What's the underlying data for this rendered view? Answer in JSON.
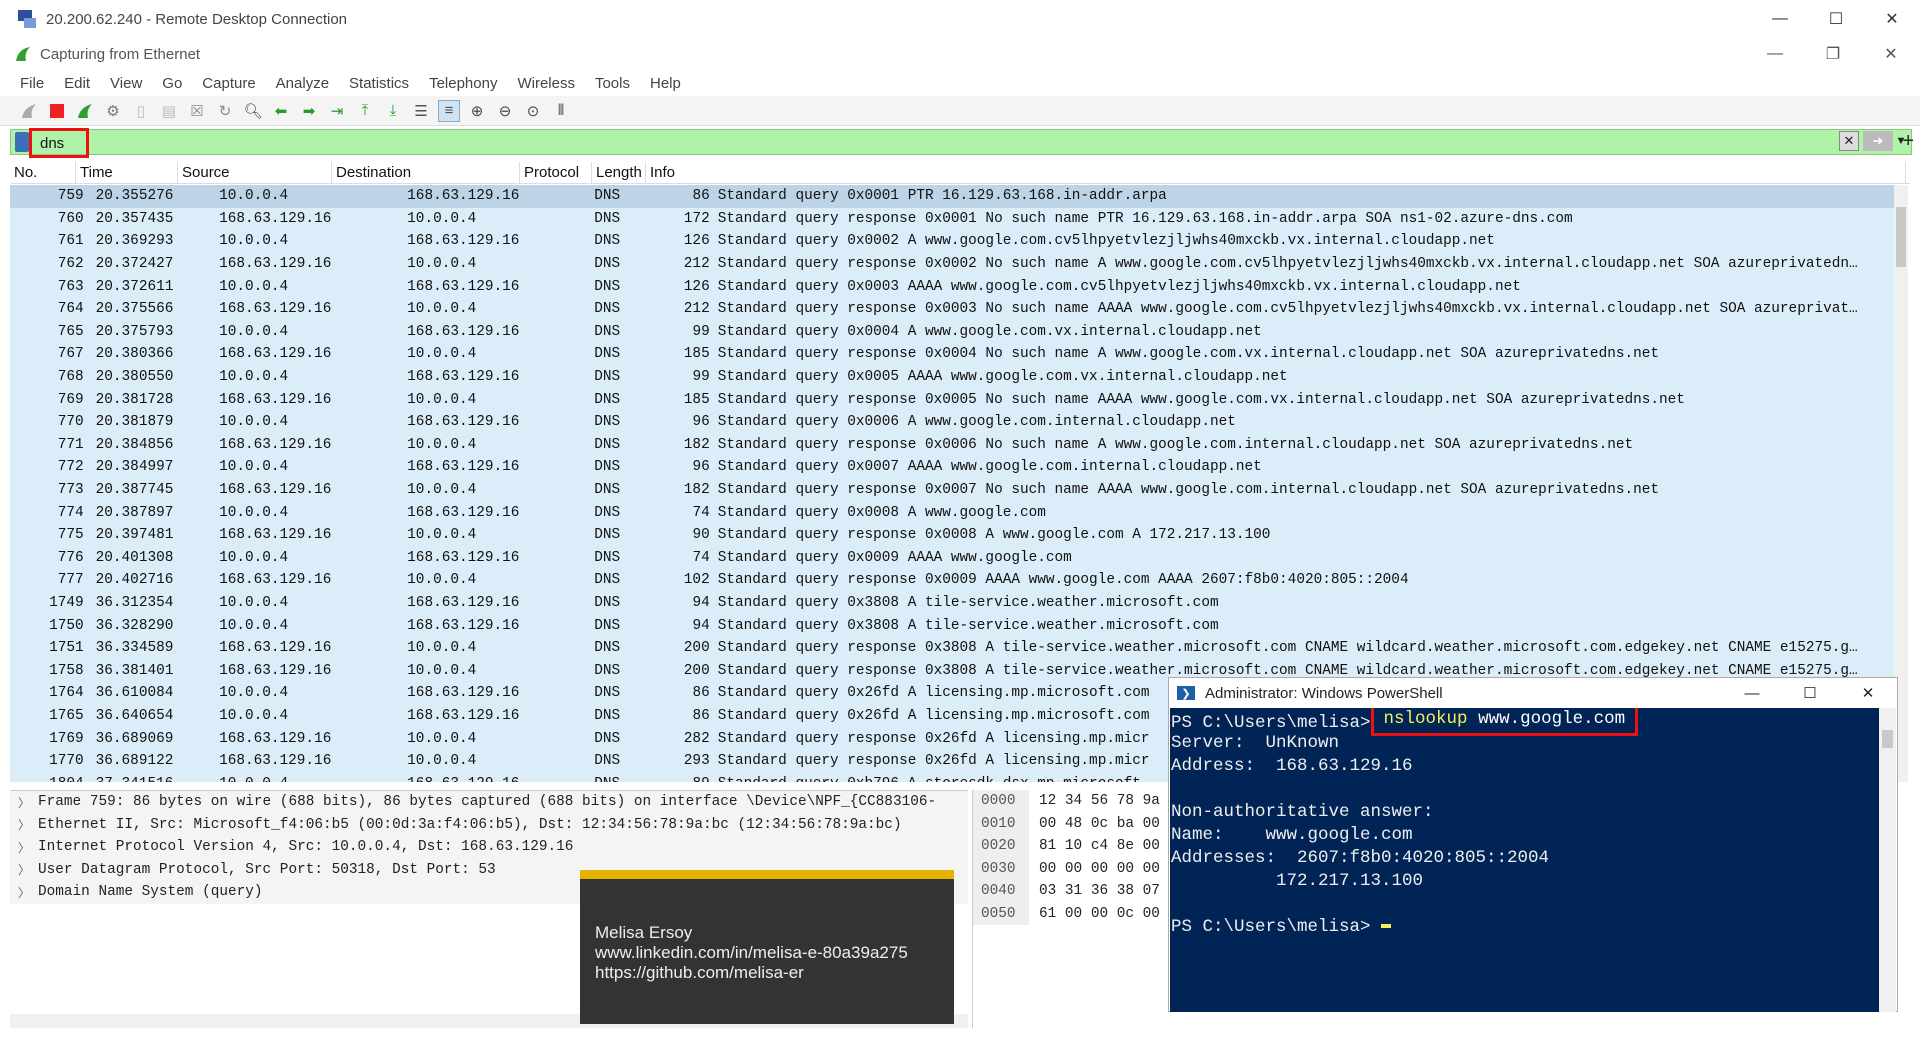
{
  "window": {
    "title": "20.200.62.240 - Remote Desktop Connection",
    "minimize": "—",
    "maximize": "☐",
    "close": "✕"
  },
  "wireshark": {
    "title": "Capturing from Ethernet",
    "menu": [
      "File",
      "Edit",
      "View",
      "Go",
      "Capture",
      "Analyze",
      "Statistics",
      "Telephony",
      "Wireless",
      "Tools",
      "Help"
    ],
    "filter": {
      "value": "dns"
    },
    "columns": [
      "No.",
      "Time",
      "Source",
      "Destination",
      "Protocol",
      "Length",
      "Info"
    ],
    "packets": [
      {
        "no": "759",
        "time": "20.355276",
        "src": "10.0.0.4",
        "dst": "168.63.129.16",
        "proto": "DNS",
        "len": "86",
        "info": "Standard query 0x0001 PTR 16.129.63.168.in-addr.arpa"
      },
      {
        "no": "760",
        "time": "20.357435",
        "src": "168.63.129.16",
        "dst": "10.0.0.4",
        "proto": "DNS",
        "len": "172",
        "info": "Standard query response 0x0001 No such name PTR 16.129.63.168.in-addr.arpa SOA ns1-02.azure-dns.com"
      },
      {
        "no": "761",
        "time": "20.369293",
        "src": "10.0.0.4",
        "dst": "168.63.129.16",
        "proto": "DNS",
        "len": "126",
        "info": "Standard query 0x0002 A www.google.com.cv5lhpyetvlezjljwhs40mxckb.vx.internal.cloudapp.net"
      },
      {
        "no": "762",
        "time": "20.372427",
        "src": "168.63.129.16",
        "dst": "10.0.0.4",
        "proto": "DNS",
        "len": "212",
        "info": "Standard query response 0x0002 No such name A www.google.com.cv5lhpyetvlezjljwhs40mxckb.vx.internal.cloudapp.net SOA azureprivatedn…"
      },
      {
        "no": "763",
        "time": "20.372611",
        "src": "10.0.0.4",
        "dst": "168.63.129.16",
        "proto": "DNS",
        "len": "126",
        "info": "Standard query 0x0003 AAAA www.google.com.cv5lhpyetvlezjljwhs40mxckb.vx.internal.cloudapp.net"
      },
      {
        "no": "764",
        "time": "20.375566",
        "src": "168.63.129.16",
        "dst": "10.0.0.4",
        "proto": "DNS",
        "len": "212",
        "info": "Standard query response 0x0003 No such name AAAA www.google.com.cv5lhpyetvlezjljwhs40mxckb.vx.internal.cloudapp.net SOA azureprivat…"
      },
      {
        "no": "765",
        "time": "20.375793",
        "src": "10.0.0.4",
        "dst": "168.63.129.16",
        "proto": "DNS",
        "len": "99",
        "info": "Standard query 0x0004 A www.google.com.vx.internal.cloudapp.net"
      },
      {
        "no": "767",
        "time": "20.380366",
        "src": "168.63.129.16",
        "dst": "10.0.0.4",
        "proto": "DNS",
        "len": "185",
        "info": "Standard query response 0x0004 No such name A www.google.com.vx.internal.cloudapp.net SOA azureprivatedns.net"
      },
      {
        "no": "768",
        "time": "20.380550",
        "src": "10.0.0.4",
        "dst": "168.63.129.16",
        "proto": "DNS",
        "len": "99",
        "info": "Standard query 0x0005 AAAA www.google.com.vx.internal.cloudapp.net"
      },
      {
        "no": "769",
        "time": "20.381728",
        "src": "168.63.129.16",
        "dst": "10.0.0.4",
        "proto": "DNS",
        "len": "185",
        "info": "Standard query response 0x0005 No such name AAAA www.google.com.vx.internal.cloudapp.net SOA azureprivatedns.net"
      },
      {
        "no": "770",
        "time": "20.381879",
        "src": "10.0.0.4",
        "dst": "168.63.129.16",
        "proto": "DNS",
        "len": "96",
        "info": "Standard query 0x0006 A www.google.com.internal.cloudapp.net"
      },
      {
        "no": "771",
        "time": "20.384856",
        "src": "168.63.129.16",
        "dst": "10.0.0.4",
        "proto": "DNS",
        "len": "182",
        "info": "Standard query response 0x0006 No such name A www.google.com.internal.cloudapp.net SOA azureprivatedns.net"
      },
      {
        "no": "772",
        "time": "20.384997",
        "src": "10.0.0.4",
        "dst": "168.63.129.16",
        "proto": "DNS",
        "len": "96",
        "info": "Standard query 0x0007 AAAA www.google.com.internal.cloudapp.net"
      },
      {
        "no": "773",
        "time": "20.387745",
        "src": "168.63.129.16",
        "dst": "10.0.0.4",
        "proto": "DNS",
        "len": "182",
        "info": "Standard query response 0x0007 No such name AAAA www.google.com.internal.cloudapp.net SOA azureprivatedns.net"
      },
      {
        "no": "774",
        "time": "20.387897",
        "src": "10.0.0.4",
        "dst": "168.63.129.16",
        "proto": "DNS",
        "len": "74",
        "info": "Standard query 0x0008 A www.google.com"
      },
      {
        "no": "775",
        "time": "20.397481",
        "src": "168.63.129.16",
        "dst": "10.0.0.4",
        "proto": "DNS",
        "len": "90",
        "info": "Standard query response 0x0008 A www.google.com A 172.217.13.100"
      },
      {
        "no": "776",
        "time": "20.401308",
        "src": "10.0.0.4",
        "dst": "168.63.129.16",
        "proto": "DNS",
        "len": "74",
        "info": "Standard query 0x0009 AAAA www.google.com"
      },
      {
        "no": "777",
        "time": "20.402716",
        "src": "168.63.129.16",
        "dst": "10.0.0.4",
        "proto": "DNS",
        "len": "102",
        "info": "Standard query response 0x0009 AAAA www.google.com AAAA 2607:f8b0:4020:805::2004"
      },
      {
        "no": "1749",
        "time": "36.312354",
        "src": "10.0.0.4",
        "dst": "168.63.129.16",
        "proto": "DNS",
        "len": "94",
        "info": "Standard query 0x3808 A tile-service.weather.microsoft.com"
      },
      {
        "no": "1750",
        "time": "36.328290",
        "src": "10.0.0.4",
        "dst": "168.63.129.16",
        "proto": "DNS",
        "len": "94",
        "info": "Standard query 0x3808 A tile-service.weather.microsoft.com"
      },
      {
        "no": "1751",
        "time": "36.334589",
        "src": "168.63.129.16",
        "dst": "10.0.0.4",
        "proto": "DNS",
        "len": "200",
        "info": "Standard query response 0x3808 A tile-service.weather.microsoft.com CNAME wildcard.weather.microsoft.com.edgekey.net CNAME e15275.g…"
      },
      {
        "no": "1758",
        "time": "36.381401",
        "src": "168.63.129.16",
        "dst": "10.0.0.4",
        "proto": "DNS",
        "len": "200",
        "info": "Standard query response 0x3808 A tile-service.weather.microsoft.com CNAME wildcard.weather.microsoft.com.edgekey.net CNAME e15275.g…"
      },
      {
        "no": "1764",
        "time": "36.610084",
        "src": "10.0.0.4",
        "dst": "168.63.129.16",
        "proto": "DNS",
        "len": "86",
        "info": "Standard query 0x26fd A licensing.mp.microsoft.com"
      },
      {
        "no": "1765",
        "time": "36.640654",
        "src": "10.0.0.4",
        "dst": "168.63.129.16",
        "proto": "DNS",
        "len": "86",
        "info": "Standard query 0x26fd A licensing.mp.microsoft.com"
      },
      {
        "no": "1769",
        "time": "36.689069",
        "src": "168.63.129.16",
        "dst": "10.0.0.4",
        "proto": "DNS",
        "len": "282",
        "info": "Standard query response 0x26fd A licensing.mp.micr"
      },
      {
        "no": "1770",
        "time": "36.689122",
        "src": "168.63.129.16",
        "dst": "10.0.0.4",
        "proto": "DNS",
        "len": "293",
        "info": "Standard query response 0x26fd A licensing.mp.micr"
      },
      {
        "no": "1804",
        "time": "37.341516",
        "src": "10.0.0.4",
        "dst": "168.63.129.16",
        "proto": "DNS",
        "len": "89",
        "info": "Standard query 0xb796 A storesdk.dsx.mp.microsoft"
      }
    ],
    "details": [
      "Frame 759: 86 bytes on wire (688 bits), 86 bytes captured (688 bits) on interface \\Device\\NPF_{CC883106-",
      "Ethernet II, Src: Microsoft_f4:06:b5 (00:0d:3a:f4:06:b5), Dst: 12:34:56:78:9a:bc (12:34:56:78:9a:bc)",
      "Internet Protocol Version 4, Src: 10.0.0.4, Dst: 168.63.129.16",
      "User Datagram Protocol, Src Port: 50318, Dst Port: 53",
      "Domain Name System (query)"
    ],
    "bytes": [
      {
        "off": "0000",
        "hex": "12 34 56 78 9a"
      },
      {
        "off": "0010",
        "hex": "00 48 0c ba 00"
      },
      {
        "off": "0020",
        "hex": "81 10 c4 8e 00"
      },
      {
        "off": "0030",
        "hex": "00 00 00 00 00"
      },
      {
        "off": "0040",
        "hex": "03 31 36 38 07"
      },
      {
        "off": "0050",
        "hex": "61 00 00 0c 00"
      }
    ]
  },
  "overlay": {
    "name": "Melisa Ersoy",
    "linkedin": "www.linkedin.com/in/melisa-e-80a39a275",
    "github": "https://github.com/melisa-er"
  },
  "powershell": {
    "title": "Administrator: Windows PowerShell",
    "prompt": "PS C:\\Users\\melisa>",
    "command": "nslookup",
    "argument": "www.google.com",
    "output": [
      "Server:  UnKnown",
      "Address:  168.63.129.16",
      "",
      "Non-authoritative answer:",
      "Name:    www.google.com",
      "Addresses:  2607:f8b0:4020:805::2004",
      "          172.217.13.100",
      ""
    ],
    "final_prompt": "PS C:\\Users\\melisa> "
  }
}
